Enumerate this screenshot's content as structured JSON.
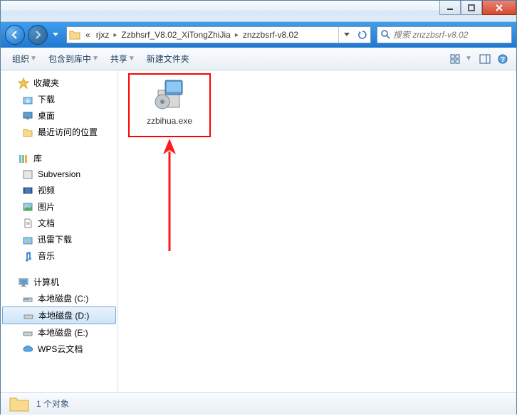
{
  "breadcrumb": {
    "ellipsis": "«",
    "items": [
      "rjxz",
      "Zzbhsrf_V8.02_XiTongZhiJia",
      "znzzbsrf-v8.02"
    ]
  },
  "search": {
    "placeholder": "搜索 znzzbsrf-v8.02"
  },
  "toolbar": {
    "organize": "组织",
    "include": "包含到库中",
    "share": "共享",
    "newfolder": "新建文件夹"
  },
  "sidebar": {
    "favorites": {
      "label": "收藏夹",
      "items": [
        "下载",
        "桌面",
        "最近访问的位置"
      ]
    },
    "libraries": {
      "label": "库",
      "items": [
        "Subversion",
        "视频",
        "图片",
        "文档",
        "迅雷下载",
        "音乐"
      ]
    },
    "computer": {
      "label": "计算机",
      "items": [
        "本地磁盘 (C:)",
        "本地磁盘 (D:)",
        "本地磁盘 (E:)",
        "WPS云文档"
      ]
    }
  },
  "file": {
    "name": "zzbihua.exe"
  },
  "status": {
    "count": "1 个对象"
  }
}
